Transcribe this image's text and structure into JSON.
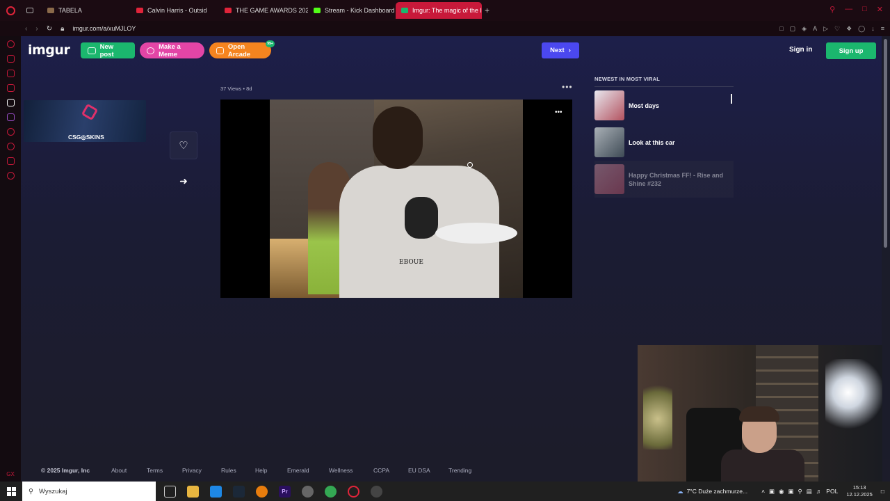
{
  "browser": {
    "tabs": [
      {
        "label": "TABELA",
        "color": "#8a6a4a",
        "active": false
      },
      {
        "label": "Calvin Harris - Outsid",
        "color": "#e0243a",
        "active": false
      },
      {
        "label": "THE GAME AWARDS 202",
        "color": "#e0243a",
        "active": false
      },
      {
        "label": "Stream - Kick Dashboard",
        "color": "#53fc18",
        "active": false
      },
      {
        "label": "Imgur: The magic of the I",
        "color": "#1bb76e",
        "active": true
      }
    ],
    "new_tab": "+",
    "url": "imgur.com/a/xuMJLOY"
  },
  "header": {
    "logo": "imgur",
    "new_post": "New post",
    "make_meme": "Make a Meme",
    "open_arcade": "Open Arcade",
    "arcade_badge": "99+",
    "next": "Next",
    "sign_in": "Sign in",
    "sign_up": "Sign up"
  },
  "ad": {
    "text": "CSG◎SKINS"
  },
  "post": {
    "meta": "37 Views • 8d",
    "shirt_text": "EBOUE"
  },
  "newest": {
    "title": "NEWEST IN MOST VIRAL",
    "items": [
      {
        "title": "Most days",
        "thumb": "#b3525f"
      },
      {
        "title": "Look at this car",
        "thumb": "#6d7a86"
      },
      {
        "title": "Happy Christmas FF! - Rise and Shine #232",
        "thumb": "#c9586a"
      }
    ]
  },
  "footer": {
    "copyright": "© 2025 Imgur, Inc",
    "links": [
      "About",
      "Terms",
      "Privacy",
      "Rules",
      "Help",
      "Emerald",
      "Wellness",
      "CCPA",
      "EU DSA",
      "Trending"
    ]
  },
  "taskbar": {
    "search_placeholder": "Wyszukaj",
    "weather": "7°C  Duże zachmurze...",
    "lang": "POL",
    "time": "15:13",
    "date": "12.12.2025"
  },
  "sidebar": {
    "bottom_label": "GX"
  }
}
